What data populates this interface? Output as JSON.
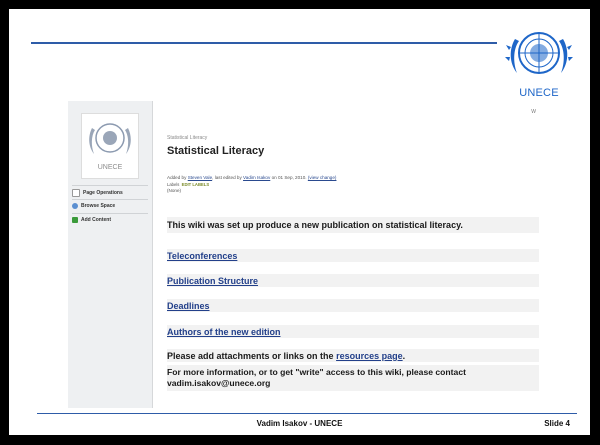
{
  "slide": {
    "logo_caption": "UNECE",
    "footer_author": "Vadim Isakov - UNECE",
    "footer_slide": "Slide 4"
  },
  "screenshot": {
    "corner_text": "W",
    "sidebar": {
      "logo_caption": "UNECE",
      "items": [
        {
          "label": "Page Operations",
          "icon": "page-icon"
        },
        {
          "label": "Browse Space",
          "icon": "globe-icon"
        },
        {
          "label": "Add Content",
          "icon": "plus-icon"
        }
      ]
    },
    "page": {
      "breadcrumb": "Statistical Literacy",
      "title": "Statistical Literacy",
      "meta_added_by_prefix": "Added by",
      "meta_author": "Steven Vale",
      "meta_edited_prefix": ", last edited by",
      "meta_editor": "Vadim Isakov",
      "meta_date": "on 01 Sep, 2010.",
      "meta_view_change": "(view change)",
      "labels_prefix": "Labels",
      "labels_edit": "EDIT LABELS",
      "labels_value": "(None)",
      "intro": "This wiki was set up produce a new publication on statistical literacy.",
      "links": [
        "Teleconferences",
        "Publication Structure",
        "Deadlines",
        "Authors of the new edition"
      ],
      "attach_prefix": "Please add attachments or links on the",
      "attach_link": "resources page",
      "attach_suffix": ".",
      "contact_line1": "For more information, or to get \"write\" access to this wiki, please contact",
      "contact_line2": "vadim.isakov@unece.org"
    }
  }
}
